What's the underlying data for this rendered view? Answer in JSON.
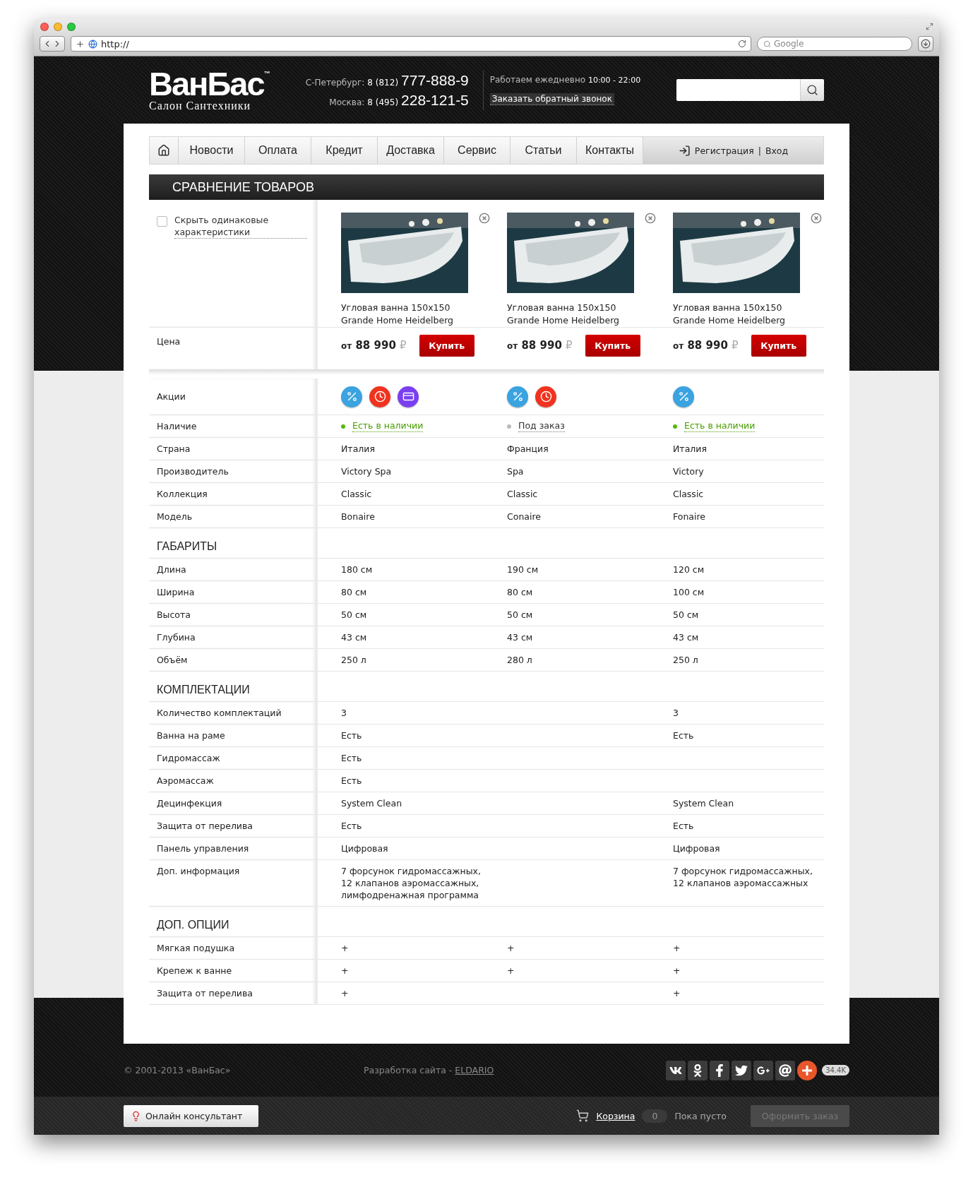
{
  "browser": {
    "url": "http://",
    "search_placeholder": "Google"
  },
  "header": {
    "logo": "ВанБас",
    "logo_mark": "™",
    "tagline": "Салон Сантехники",
    "phones": [
      {
        "city": "С-Петербург:",
        "code": "8 (812)",
        "number": "777-888-9"
      },
      {
        "city": "Москва:",
        "code": "8 (495)",
        "number": "228-121-5"
      }
    ],
    "hours_label": "Работаем ежедневно",
    "hours": "10:00 - 22:00",
    "callback": "Заказать обратный звонок"
  },
  "nav": {
    "items": [
      "Новости",
      "Оплата",
      "Кредит",
      "Доставка",
      "Сервис",
      "Статьи",
      "Контакты"
    ],
    "register": "Регистрация",
    "separator": "|",
    "login": "Вход"
  },
  "title": "СРАВНЕНИЕ ТОВАРОВ",
  "hide_same": {
    "label": "Скрыть одинаковые характеристики",
    "checked": false
  },
  "price_label": "Цена",
  "products": [
    {
      "name": "Угловая ванна 150x150 Grande Home Heidelberg",
      "price_prefix": "от",
      "price": "88 990",
      "currency": "₽",
      "buy": "Купить"
    },
    {
      "name": "Угловая ванна 150x150 Grande Home Heidelberg",
      "price_prefix": "от",
      "price": "88 990",
      "currency": "₽",
      "buy": "Купить"
    },
    {
      "name": "Угловая ванна 150x150 Grande Home Heidelberg",
      "price_prefix": "от",
      "price": "88 990",
      "currency": "₽",
      "buy": "Купить"
    }
  ],
  "promo_label": "Акции",
  "promos": [
    [
      {
        "kind": "discount"
      },
      {
        "kind": "timer"
      },
      {
        "kind": "card"
      }
    ],
    [
      {
        "kind": "discount"
      },
      {
        "kind": "timer"
      }
    ],
    [
      {
        "kind": "discount"
      }
    ]
  ],
  "availability_label": "Наличие",
  "availability": [
    {
      "text": "Есть в наличии",
      "in_stock": true
    },
    {
      "text": "Под заказ",
      "in_stock": false
    },
    {
      "text": "Есть в наличии",
      "in_stock": true
    }
  ],
  "groups": [
    {
      "rows": [
        {
          "label": "Страна",
          "values": [
            "Италия",
            "Франция",
            "Италия"
          ]
        },
        {
          "label": "Производитель",
          "values": [
            "Victory Spa",
            "Spa",
            "Victory"
          ]
        },
        {
          "label": "Коллекция",
          "values": [
            "Classic",
            "Classic",
            "Classic"
          ]
        },
        {
          "label": "Модель",
          "values": [
            "Bonaire",
            "Conaire",
            "Fonaire"
          ]
        }
      ]
    },
    {
      "heading": "ГАБАРИТЫ",
      "rows": [
        {
          "label": "Длина",
          "values": [
            "180 см",
            "190 см",
            "120 см"
          ]
        },
        {
          "label": "Ширина",
          "values": [
            "80 см",
            "80 см",
            "100 см"
          ]
        },
        {
          "label": "Высота",
          "values": [
            "50 см",
            "50 см",
            "50 см"
          ]
        },
        {
          "label": "Глубина",
          "values": [
            "43 см",
            "43 см",
            "43 см"
          ]
        },
        {
          "label": "Объём",
          "values": [
            "250 л",
            "280 л",
            "250 л"
          ]
        }
      ]
    },
    {
      "heading": "КОМПЛЕКТАЦИИ",
      "rows": [
        {
          "label": "Количество комплектаций",
          "values": {
            "product_1": "3",
            "product_3": "3"
          }
        },
        {
          "label": "Ванна на раме",
          "values": {
            "product_1": "Есть",
            "product_3": "Есть"
          }
        },
        {
          "label": "Гидромассаж",
          "values": {
            "product_1": "Есть"
          }
        },
        {
          "label": "Аэромассаж",
          "values": {
            "product_1": "Есть"
          }
        },
        {
          "label": "Децинфекция",
          "values": {
            "product_1": "System Clean",
            "product_3": "System Clean"
          }
        },
        {
          "label": "Защита от перелива",
          "values": {
            "product_1": "Есть",
            "product_3": "Есть"
          }
        },
        {
          "label": "Панель управления",
          "values": {
            "product_1": "Цифровая",
            "product_3": "Цифровая"
          }
        },
        {
          "label": "Доп. информация",
          "values": {
            "product_1": "7 форсунок гидромассажных, 12 клапанов аэромассажных, лимфодренажная программа",
            "product_3": "7 форсунок гидромассажных, 12 клапанов аэромассажных"
          }
        }
      ]
    },
    {
      "heading": "ДОП. ОПЦИИ",
      "rows": [
        {
          "label": "Мягкая подушка",
          "values": [
            "+",
            "+",
            "+"
          ]
        },
        {
          "label": "Крепеж к ванне",
          "values": [
            "+",
            "+",
            "+"
          ]
        },
        {
          "label": "Защита от перелива",
          "values": {
            "product_1": "+",
            "product_3": "+"
          }
        }
      ]
    }
  ],
  "footer": {
    "copyright": "© 2001-2013 «ВанБас»",
    "dev_label": "Разработка сайта -",
    "dev_link": "ELDARIO",
    "social": [
      {
        "kind": "vk"
      },
      {
        "kind": "ok"
      },
      {
        "kind": "facebook"
      },
      {
        "kind": "twitter"
      },
      {
        "kind": "gplus"
      },
      {
        "kind": "mail"
      },
      {
        "kind": "share"
      }
    ],
    "share_count": "34.4K"
  },
  "bottom_bar": {
    "consultant": "Онлайн консультант",
    "cart": "Корзина",
    "cart_count": "0",
    "cart_status": "Пока пусто",
    "checkout": "Оформить заказ",
    "checkout_disabled": true
  }
}
